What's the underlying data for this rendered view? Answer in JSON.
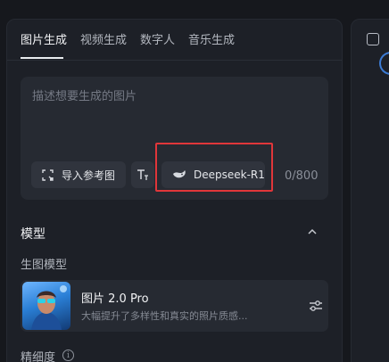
{
  "tabs": [
    {
      "label": "图片生成",
      "active": true
    },
    {
      "label": "视频生成",
      "active": false
    },
    {
      "label": "数字人",
      "active": false
    },
    {
      "label": "音乐生成",
      "active": false
    }
  ],
  "prompt": {
    "placeholder": "描述想要生成的图片",
    "value": "",
    "counter": "0/800"
  },
  "chips": {
    "reference_image": "导入参考图",
    "text_icon": "text-format-icon",
    "model_label": "Deepseek-R1"
  },
  "model_section": {
    "title": "模型",
    "sub_label": "生图模型",
    "card": {
      "name": "图片 2.0 Pro",
      "description": "大幅提升了多样性和真实的照片质感..."
    }
  },
  "detail": {
    "label": "精细度",
    "info_icon": "i"
  },
  "colors": {
    "background": "#16181d",
    "panel": "#1d2027",
    "input": "#262a32",
    "highlight": "#e0363a",
    "accent_blue": "#3c7bd3"
  }
}
